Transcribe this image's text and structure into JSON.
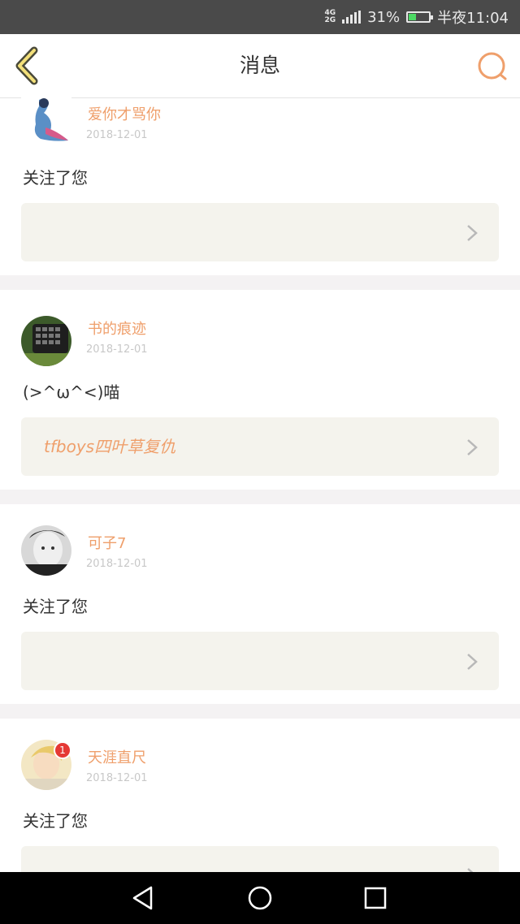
{
  "status_bar": {
    "network_top": "4G",
    "network_bottom": "2G",
    "battery": "31%",
    "time": "半夜11:04"
  },
  "header": {
    "title": "消息",
    "back_icon": "chevron-left-icon",
    "search_icon": "search-icon",
    "accent_color": "#ef9f6b"
  },
  "messages": [
    {
      "username": "爱你才骂你",
      "date": "2018-12-01",
      "text": "关注了您",
      "ref_text": ""
    },
    {
      "username": "书的痕迹",
      "date": "2018-12-01",
      "text": "(>^ω^<)喵",
      "ref_text": "tfboys四叶草复仇"
    },
    {
      "username": "可子7",
      "date": "2018-12-01",
      "text": "关注了您",
      "ref_text": ""
    },
    {
      "username": "天涯直尺",
      "date": "2018-12-01",
      "text": "关注了您",
      "ref_text": "",
      "badge": "1"
    }
  ],
  "system_nav": {
    "back": "triangle-back-icon",
    "home": "circle-home-icon",
    "recents": "square-recents-icon"
  }
}
